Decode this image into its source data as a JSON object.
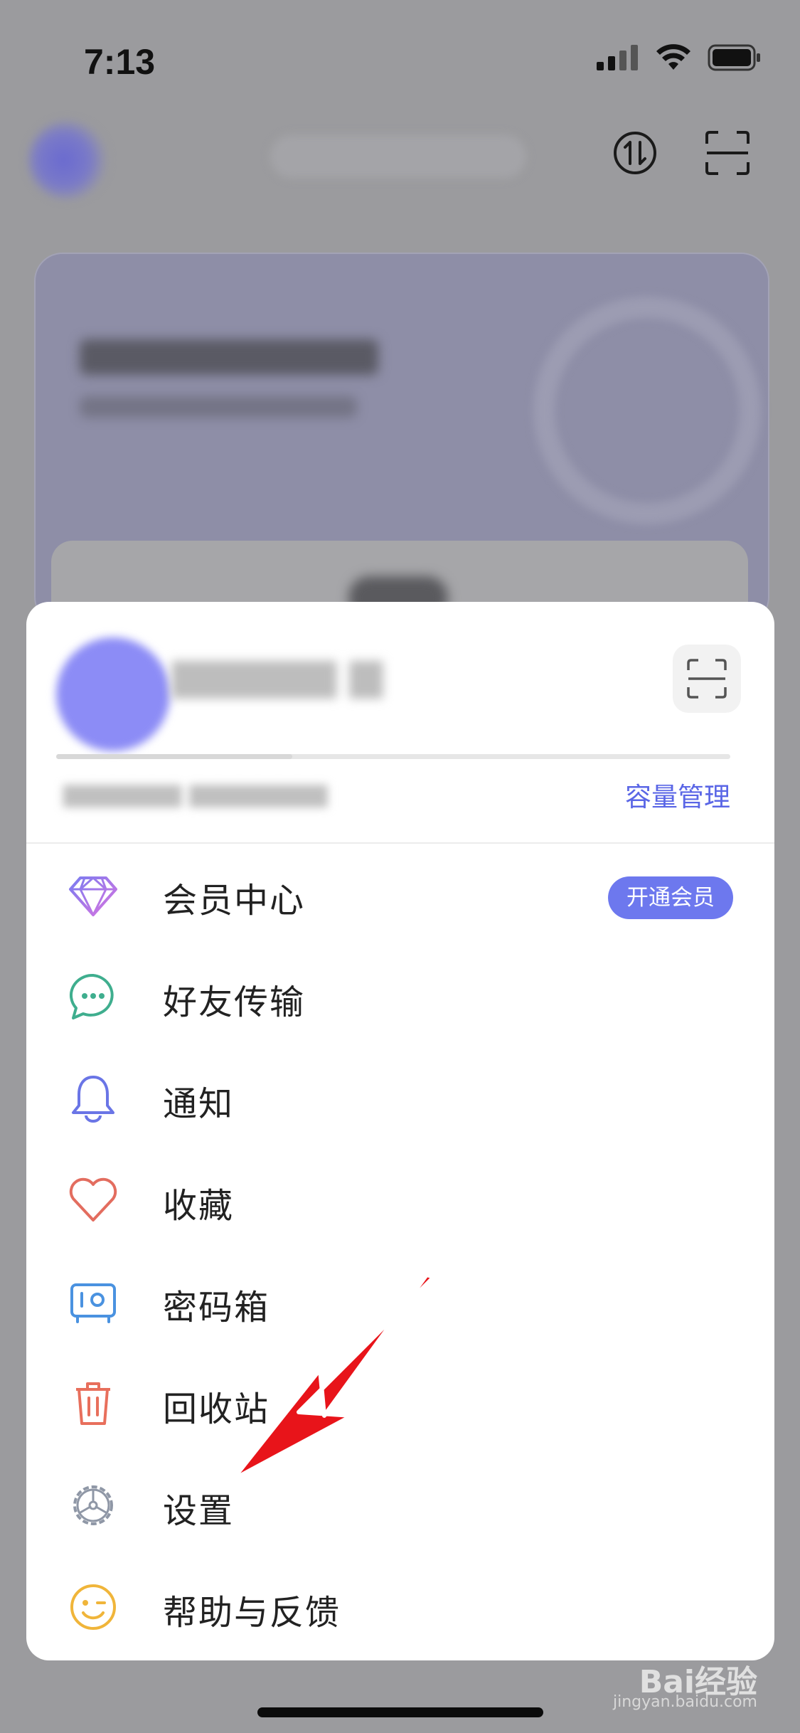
{
  "status_bar": {
    "time": "7:13"
  },
  "panel": {
    "capacity_link": "容量管理",
    "vip_badge": "开通会员",
    "menu": [
      {
        "label": "会员中心",
        "icon": "diamond-icon"
      },
      {
        "label": "好友传输",
        "icon": "chat-bubble-icon"
      },
      {
        "label": "通知",
        "icon": "bell-icon"
      },
      {
        "label": "收藏",
        "icon": "heart-icon"
      },
      {
        "label": "密码箱",
        "icon": "safe-box-icon"
      },
      {
        "label": "回收站",
        "icon": "trash-icon"
      },
      {
        "label": "设置",
        "icon": "gear-icon"
      },
      {
        "label": "帮助与反馈",
        "icon": "wink-smiley-icon"
      }
    ]
  },
  "watermark": {
    "brand": "Bai经验",
    "url": "jingyan.baidu.com"
  },
  "colors": {
    "accent": "#6d78ee",
    "link": "#5a66e6",
    "annotation_arrow": "#e8141a"
  }
}
